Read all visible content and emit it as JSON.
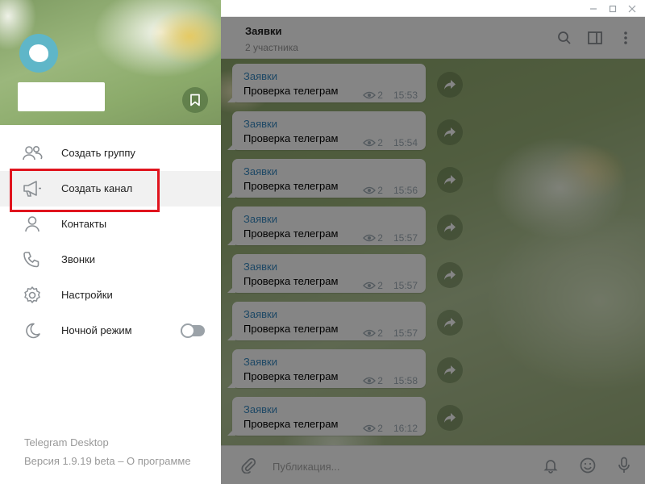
{
  "window": {
    "buttons": [
      "minimize",
      "maximize",
      "close"
    ]
  },
  "chat": {
    "title": "Заявки",
    "subtitle": "2 участника",
    "composer_placeholder": "Публикация...",
    "messages": [
      {
        "author": "Заявки",
        "text": "Проверка телеграм",
        "views": "2",
        "time": "15:53"
      },
      {
        "author": "Заявки",
        "text": "Проверка телеграм",
        "views": "2",
        "time": "15:54"
      },
      {
        "author": "Заявки",
        "text": "Проверка телеграм",
        "views": "2",
        "time": "15:56"
      },
      {
        "author": "Заявки",
        "text": "Проверка телеграм",
        "views": "2",
        "time": "15:57"
      },
      {
        "author": "Заявки",
        "text": "Проверка телеграм",
        "views": "2",
        "time": "15:57"
      },
      {
        "author": "Заявки",
        "text": "Проверка телеграм",
        "views": "2",
        "time": "15:57"
      },
      {
        "author": "Заявки",
        "text": "Проверка телеграм",
        "views": "2",
        "time": "15:58"
      },
      {
        "author": "Заявки",
        "text": "Проверка телеграм",
        "views": "2",
        "time": "16:12"
      }
    ]
  },
  "menu": {
    "items": [
      {
        "label": "Создать группу",
        "icon": "people-icon"
      },
      {
        "label": "Создать канал",
        "icon": "megaphone-icon"
      },
      {
        "label": "Контакты",
        "icon": "person-icon"
      },
      {
        "label": "Звонки",
        "icon": "phone-icon"
      },
      {
        "label": "Настройки",
        "icon": "gear-icon"
      },
      {
        "label": "Ночной режим",
        "icon": "moon-icon"
      }
    ],
    "night_mode_on": false
  },
  "footer": {
    "app_name": "Telegram Desktop",
    "version": "Версия 1.9.19 beta – О программе"
  },
  "colors": {
    "accent": "#3a8bc2",
    "highlight_frame": "#e0141e",
    "avatar": "#5fb6c8"
  }
}
